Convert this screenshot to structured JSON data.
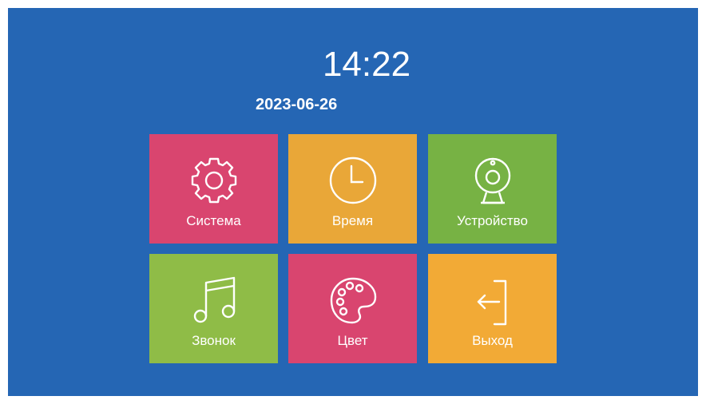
{
  "time": "14:22",
  "date": "2023-06-26",
  "colors": {
    "background": "#2566b4",
    "pink": "#d9456f",
    "orange": "#e9a738",
    "green": "#77b244",
    "lime": "#8fbc47",
    "amber": "#f2aa36"
  },
  "menu": [
    {
      "label": "Система",
      "icon": "gear-icon",
      "color": "#d9456f"
    },
    {
      "label": "Время",
      "icon": "clock-icon",
      "color": "#e9a738"
    },
    {
      "label": "Устройство",
      "icon": "webcam-icon",
      "color": "#77b244"
    },
    {
      "label": "Звонок",
      "icon": "music-note-icon",
      "color": "#8fbc47"
    },
    {
      "label": "Цвет",
      "icon": "palette-icon",
      "color": "#d9456f"
    },
    {
      "label": "Выход",
      "icon": "exit-icon",
      "color": "#f2aa36"
    }
  ]
}
